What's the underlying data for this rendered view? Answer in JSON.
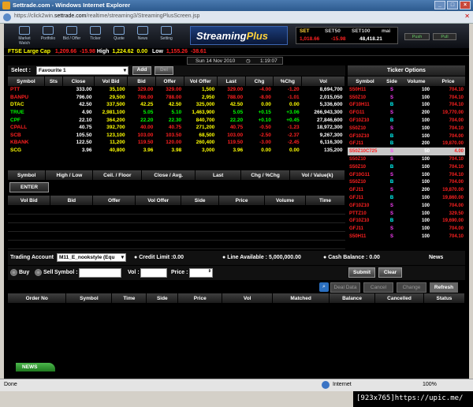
{
  "window": {
    "title": "Settrade.com - Windows Internet Explorer",
    "url_prefix": "https://click2win.",
    "url_host": "settrade.com",
    "url_path": "/realtime/streaming3/StreamingPlusScreen.jsp"
  },
  "toolbar": {
    "buttons": [
      "Market Watch",
      "Portfolio",
      "Bid / Offer",
      "Ticker",
      "Quote",
      "News",
      "Setting"
    ],
    "logo_main": "Streaming",
    "logo_accent": "Plus"
  },
  "index_box": {
    "tabs": [
      "SET",
      "SET50",
      "SET100",
      "mai"
    ],
    "values": [
      "1,018.66",
      "-15.98",
      "48,418.21"
    ],
    "push_label": "Push",
    "pull_label": "Pull"
  },
  "market_ticker": {
    "label": "FTSE Large Cap",
    "value": "1,209.66",
    "change": "-15.98",
    "high_label": "High",
    "high_value": "1,224.62",
    "high_change": "0.00",
    "low_label": "Low",
    "low_value": "1,155.26",
    "low_change": "-38.61"
  },
  "datebar": {
    "date": "Sun 14 Nov 2010",
    "time": "1:19:07"
  },
  "select_bar": {
    "label": "Select :",
    "value": "Favourite 1",
    "add_label": "Add",
    "del_label": "Del"
  },
  "quote_table": {
    "headers": [
      "Symbol",
      "Sts",
      "Close",
      "Vol Bid",
      "Bid",
      "Offer",
      "Vol Offer",
      "Last",
      "Chg",
      "%Chg",
      "Vol"
    ],
    "rows": [
      {
        "sym": "PTT",
        "sts": "",
        "close": "333.00",
        "volbid": "35,100",
        "bid": "329.00",
        "offer": "329.00",
        "voloffer": "1,500",
        "last": "329.00",
        "chg": "-4.00",
        "pchg": "-1.20",
        "vol": "8,694,700",
        "c": "red"
      },
      {
        "sym": "BANPU",
        "sts": "",
        "close": "796.00",
        "volbid": "29,500",
        "bid": "786.00",
        "offer": "788.00",
        "voloffer": "2,950",
        "last": "788.00",
        "chg": "-8.00",
        "pchg": "-1.01",
        "vol": "2,015,050",
        "c": "red"
      },
      {
        "sym": "DTAC",
        "sts": "",
        "close": "42.50",
        "volbid": "337,500",
        "bid": "42.25",
        "offer": "42.50",
        "voloffer": "325,000",
        "last": "42.50",
        "chg": "0.00",
        "pchg": "0.00",
        "vol": "5,336,600",
        "c": "yel"
      },
      {
        "sym": "TRUE",
        "sts": "",
        "close": "4.90",
        "volbid": "2,981,100",
        "bid": "5.05",
        "offer": "5.10",
        "voloffer": "1,463,900",
        "last": "5.05",
        "chg": "+0.15",
        "pchg": "+3.06",
        "vol": "266,943,300",
        "c": "green"
      },
      {
        "sym": "CPF",
        "sts": "",
        "close": "22.10",
        "volbid": "364,200",
        "bid": "22.20",
        "offer": "22.30",
        "voloffer": "840,700",
        "last": "22.20",
        "chg": "+0.10",
        "pchg": "+0.45",
        "vol": "27,846,600",
        "c": "green"
      },
      {
        "sym": "CPALL",
        "sts": "",
        "close": "40.75",
        "volbid": "392,700",
        "bid": "40.00",
        "offer": "40.75",
        "voloffer": "271,200",
        "last": "40.75",
        "chg": "-0.50",
        "pchg": "-1.23",
        "vol": "18,972,300",
        "c": "red"
      },
      {
        "sym": "SCB",
        "sts": "",
        "close": "105.50",
        "volbid": "123,100",
        "bid": "103.00",
        "offer": "103.50",
        "voloffer": "68,500",
        "last": "103.00",
        "chg": "-2.50",
        "pchg": "-2.37",
        "vol": "9,267,300",
        "c": "red"
      },
      {
        "sym": "KBANK",
        "sts": "",
        "close": "122.50",
        "volbid": "11,200",
        "bid": "119.50",
        "offer": "120.00",
        "voloffer": "260,400",
        "last": "119.50",
        "chg": "-3.00",
        "pchg": "-2.45",
        "vol": "6,116,300",
        "c": "red"
      },
      {
        "sym": "SCG",
        "sts": "",
        "close": "3.96",
        "volbid": "40,800",
        "bid": "3.96",
        "offer": "3.98",
        "voloffer": "3,000",
        "last": "3.96",
        "chg": "0.00",
        "pchg": "0.00",
        "vol": "135,200",
        "c": "yel"
      }
    ]
  },
  "ticker_panel": {
    "title": "Ticker Options",
    "headers": [
      "Symbol",
      "Side",
      "Volume",
      "Price"
    ],
    "rows": [
      {
        "sym": "S50H11",
        "side": "S",
        "vol": "100",
        "price": "704.10",
        "c": "red"
      },
      {
        "sym": "S50Z10",
        "side": "S",
        "vol": "100",
        "price": "704.10",
        "c": "red"
      },
      {
        "sym": "GF10H11",
        "side": "B",
        "vol": "100",
        "price": "704.10",
        "c": "red"
      },
      {
        "sym": "GFG11",
        "side": "S",
        "vol": "200",
        "price": "19,770.00",
        "c": "red"
      },
      {
        "sym": "GF10Z10",
        "side": "B",
        "vol": "100",
        "price": "704.00",
        "c": "red"
      },
      {
        "sym": "S50Z10",
        "side": "S",
        "vol": "100",
        "price": "704.10",
        "c": "red"
      },
      {
        "sym": "GF10Z10",
        "side": "B",
        "vol": "100",
        "price": "704.00",
        "c": "red"
      },
      {
        "sym": "GFJ11",
        "side": "B",
        "vol": "200",
        "price": "19,870.00",
        "c": "red"
      },
      {
        "sym": "S50Z10C725",
        "side": "S",
        "vol": "50",
        "price": "4.00",
        "c": "red",
        "hl": true
      },
      {
        "sym": "S50Z10",
        "side": "S",
        "vol": "100",
        "price": "704.10",
        "c": "red"
      },
      {
        "sym": "S50Z10",
        "side": "B",
        "vol": "100",
        "price": "704.10",
        "c": "red"
      },
      {
        "sym": "GF10G11",
        "side": "S",
        "vol": "100",
        "price": "704.10",
        "c": "red"
      },
      {
        "sym": "S50Z10",
        "side": "B",
        "vol": "100",
        "price": "704.00",
        "c": "red"
      },
      {
        "sym": "GFJ11",
        "side": "S",
        "vol": "200",
        "price": "19,870.00",
        "c": "red"
      },
      {
        "sym": "GFJ11",
        "side": "B",
        "vol": "100",
        "price": "19,860.00",
        "c": "red"
      },
      {
        "sym": "GF10Z10",
        "side": "S",
        "vol": "100",
        "price": "704.00",
        "c": "red"
      },
      {
        "sym": "PTTZ10",
        "side": "S",
        "vol": "100",
        "price": "329.50",
        "c": "red"
      },
      {
        "sym": "GF10Z10",
        "side": "B",
        "vol": "100",
        "price": "19,690.00",
        "c": "red"
      },
      {
        "sym": "GFJ11",
        "side": "S",
        "vol": "100",
        "price": "704.00",
        "c": "red"
      },
      {
        "sym": "S50H11",
        "side": "S",
        "vol": "100",
        "price": "704.10",
        "c": "red"
      }
    ]
  },
  "detail_header": [
    "Symbol",
    "High / Low",
    "Ceil. / Floor",
    "Close / Avg.",
    "Last",
    "Chg / %Chg",
    "Vol / Value(k)"
  ],
  "enter_label": "ENTER",
  "bidoffer_header": [
    "Vol Bid",
    "Bid",
    "Offer",
    "Vol Offer",
    "Side",
    "Price",
    "Volume",
    "Time"
  ],
  "trading": {
    "account_label": "Trading Account",
    "account_value": "M11_E_nookstyle (Equ",
    "credit_label": "Credit Limit :",
    "credit_value": "0.00",
    "line_label": "Line Available :",
    "line_value": "5,000,000.00",
    "cash_label": "Cash Balance :",
    "cash_value": "0.00",
    "news_label": "News"
  },
  "order_entry": {
    "buy_label": "Buy",
    "sell_label": "Sell",
    "symbol_label": "Symbol :",
    "vol_label": "Vol :",
    "price_label": "Price :",
    "submit_label": "Submit",
    "clear_label": "Clear"
  },
  "order_tabs": [
    "Deal Data",
    "Cancel",
    "Change",
    "Refresh"
  ],
  "order_table_headers": [
    "Order No",
    "Symbol",
    "Time",
    "Side",
    "Price",
    "Vol",
    "Matched",
    "Balance",
    "Cancelled",
    "Status"
  ],
  "news_tab": "NEWS",
  "status": {
    "left": "Done",
    "zone": "Internet",
    "zoom": "100%"
  },
  "watermark": "[923x765]https://upic.me/"
}
